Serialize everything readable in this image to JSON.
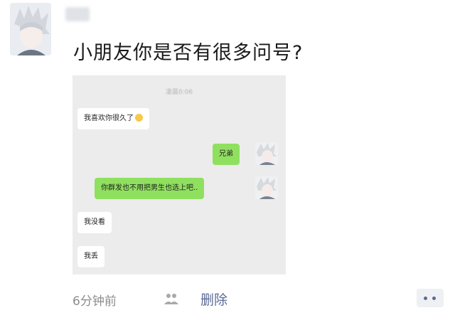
{
  "post": {
    "text": "小朋友你是否有很多问号?",
    "time_ago": "6分钟前",
    "delete_label": "删除"
  },
  "screenshot": {
    "timestamp": "凌晨0:06",
    "messages": [
      {
        "side": "left",
        "text": "我喜欢你很久了"
      },
      {
        "side": "right",
        "text": "兄弟"
      },
      {
        "side": "right",
        "text": "你群发也不用把男生也选上吧.."
      },
      {
        "side": "left",
        "text": "我没看"
      },
      {
        "side": "left",
        "text": "我丢"
      }
    ]
  },
  "icons": {
    "people": "people-icon",
    "more": "more-dots-icon",
    "emoji": "smile-emoji-icon"
  },
  "colors": {
    "link": "#5a6a96",
    "green_bubble": "#90e05f"
  }
}
